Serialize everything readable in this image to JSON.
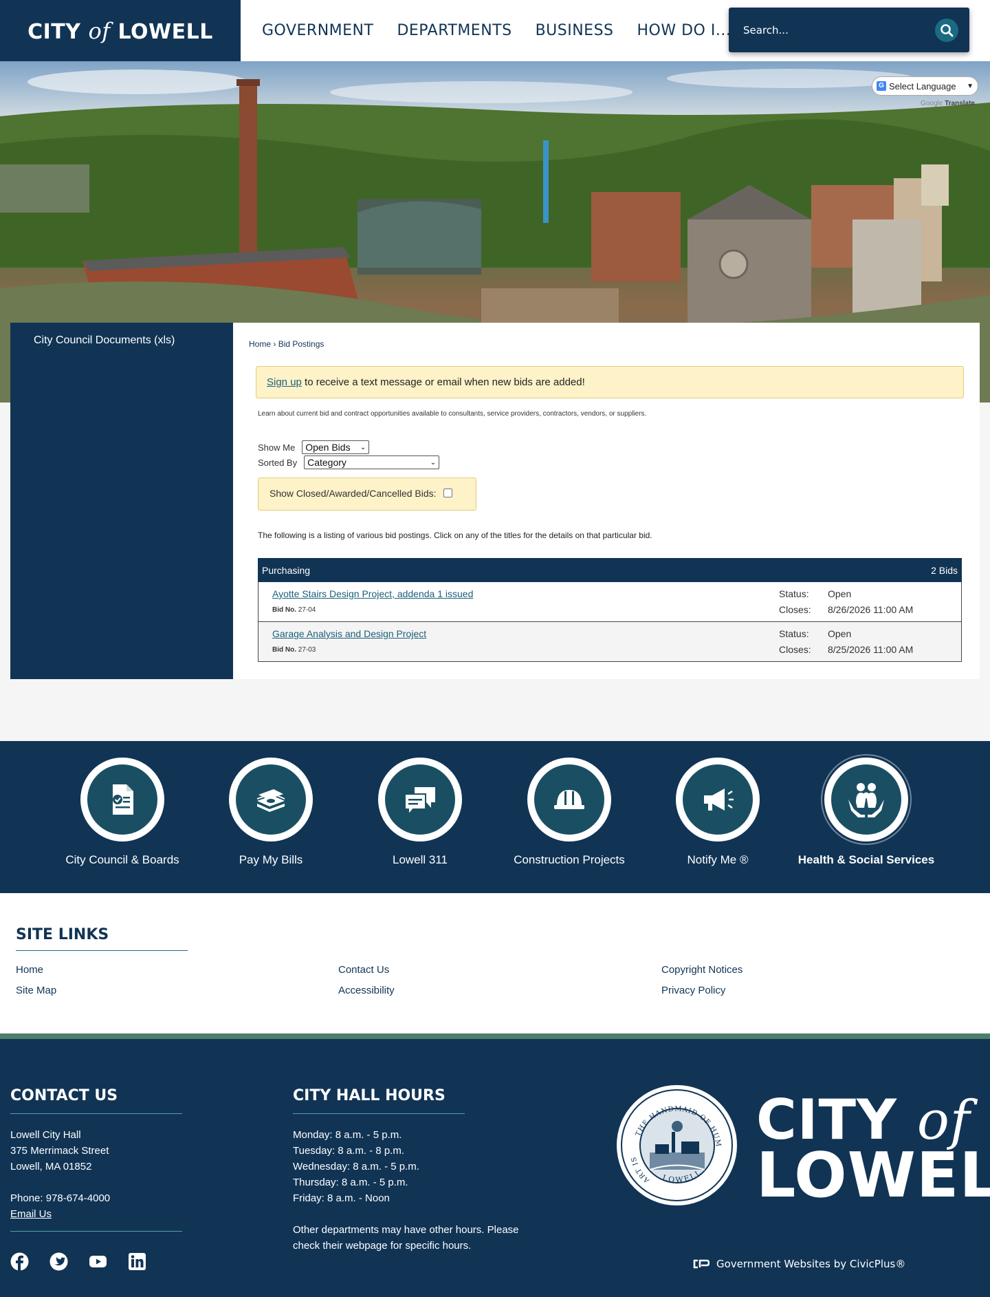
{
  "header": {
    "logo": {
      "city": "CITY",
      "of": "of",
      "name": "LOWELL"
    },
    "nav": [
      "GOVERNMENT",
      "DEPARTMENTS",
      "BUSINESS",
      "HOW DO I..."
    ],
    "search_placeholder": "Search..."
  },
  "translate": {
    "select_label": "Select Language",
    "credit_google": "Google",
    "credit_translate": "Translate"
  },
  "sidebar": {
    "items": [
      "City Council Documents (xls)"
    ]
  },
  "breadcrumb": {
    "home": "Home",
    "separator": "›",
    "current": "Bid Postings"
  },
  "alert": {
    "link": "Sign up",
    "text": " to receive a text message or email when new bids are added!"
  },
  "intro": "Learn about current bid and contract opportunities available to consultants, service providers, contractors, vendors, or suppliers.",
  "filters": {
    "show_me_label": "Show Me",
    "show_me_value": "Open Bids",
    "sorted_by_label": "Sorted By",
    "sorted_by_value": "Category",
    "closed_label": "Show Closed/Awarded/Cancelled Bids:"
  },
  "listing_note": "The following is a listing of various bid postings. Click on any of the titles for the details on that particular bid.",
  "bids": {
    "category": "Purchasing",
    "count": "2 Bids",
    "status_label": "Status:",
    "closes_label": "Closes:",
    "bid_no_label": "Bid No.",
    "items": [
      {
        "title": "Ayotte Stairs Design Project, addenda 1 issued",
        "bid_no": "27-04",
        "status": "Open",
        "closes": "8/26/2026 11:00 AM"
      },
      {
        "title": "Garage Analysis and Design Project",
        "bid_no": "27-03",
        "status": "Open",
        "closes": "8/25/2026 11:00 AM"
      }
    ]
  },
  "quick_links": [
    {
      "label": "City Council & Boards",
      "icon": "document-check-icon"
    },
    {
      "label": "Pay My Bills",
      "icon": "money-stack-icon"
    },
    {
      "label": "Lowell 311",
      "icon": "chat-bubbles-icon"
    },
    {
      "label": "Construction Projects",
      "icon": "hard-hat-icon"
    },
    {
      "label": "Notify Me ®",
      "icon": "megaphone-icon"
    },
    {
      "label": "Health & Social Services",
      "icon": "family-hands-icon"
    }
  ],
  "site_links": {
    "title": "SITE LINKS",
    "col1": [
      "Home",
      "Site Map"
    ],
    "col2": [
      "Contact Us",
      "Accessibility"
    ],
    "col3": [
      "Copyright Notices",
      "Privacy Policy"
    ]
  },
  "footer": {
    "contact": {
      "title": "CONTACT US",
      "name": "Lowell City Hall",
      "street": "375 Merrimack Street",
      "city": "Lowell, MA 01852",
      "phone": "Phone: 978-674-4000",
      "email": "Email Us"
    },
    "hours": {
      "title": "CITY HALL HOURS",
      "lines": [
        "Monday: 8 a.m. - 5 p.m.",
        "Tuesday: 8 a.m. - 8 p.m.",
        "Wednesday: 8 a.m. - 5 p.m.",
        "Thursday: 8 a.m. - 5 p.m.",
        "Friday: 8 a.m. - Noon"
      ],
      "note1": "Other departments may have other hours. Please",
      "note2": "check their webpage for specific hours."
    },
    "logo": {
      "city": "CITY",
      "of": "of",
      "name": "LOWELL"
    },
    "seal": {
      "top": "THE HANDMAID OF HUMAN GOOD",
      "left": "ART IS",
      "bottom": "LOWELL"
    },
    "social": [
      "facebook-icon",
      "twitter-icon",
      "youtube-icon",
      "linkedin-icon"
    ],
    "civicplus": "Government Websites by CivicPlus®"
  },
  "colors": {
    "navy": "#113455",
    "teal": "#1a4f63",
    "alert_bg": "#fdf2c8",
    "green_bar": "#4e7f6a"
  }
}
